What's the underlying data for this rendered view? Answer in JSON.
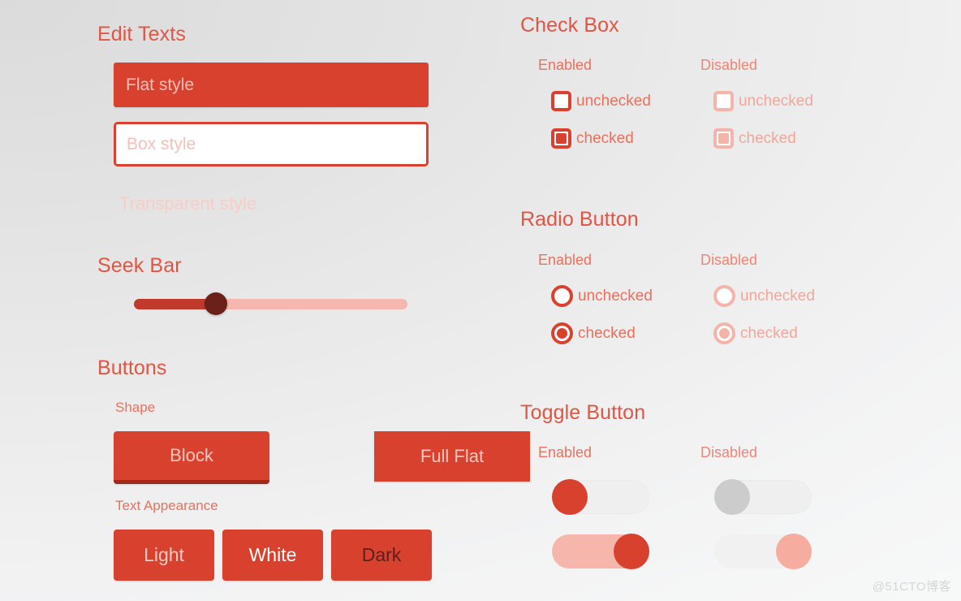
{
  "theme": {
    "accent": "#d9412f",
    "accent_dark": "#9e2a1d",
    "accent_light": "#f6b8ae",
    "text_on_accent_light": "#f6c6bf",
    "title_color": "#e05543",
    "label_color": "#e8705d",
    "disabled_color": "#f4b4a9",
    "background_from": "#dbdbdb",
    "background_to": "#f7f8f8"
  },
  "edit_texts": {
    "title": "Edit Texts",
    "flat": {
      "placeholder": "Flat style",
      "value": ""
    },
    "box": {
      "placeholder": "Box style",
      "value": ""
    },
    "transparent": {
      "placeholder": "Transparent style",
      "value": ""
    }
  },
  "seek_bar": {
    "title": "Seek Bar",
    "value": 30,
    "min": 0,
    "max": 100,
    "progress_percent": "30%"
  },
  "buttons": {
    "title": "Buttons",
    "shape": {
      "label": "Shape",
      "items": [
        {
          "label": "Block",
          "style": "block"
        },
        {
          "label": "Full Flat",
          "style": "full-flat"
        }
      ]
    },
    "text_appearance": {
      "label": "Text Appearance",
      "items": [
        {
          "label": "Light",
          "style": "light"
        },
        {
          "label": "White",
          "style": "white"
        },
        {
          "label": "Dark",
          "style": "dark"
        }
      ]
    }
  },
  "check_box": {
    "title": "Check Box",
    "columns": [
      {
        "header": "Enabled",
        "state": "enabled"
      },
      {
        "header": "Disabled",
        "state": "disabled"
      }
    ],
    "rows": [
      {
        "label": "unchecked",
        "checked": false
      },
      {
        "label": "checked",
        "checked": true
      }
    ]
  },
  "radio_button": {
    "title": "Radio Button",
    "columns": [
      {
        "header": "Enabled",
        "state": "enabled"
      },
      {
        "header": "Disabled",
        "state": "disabled"
      }
    ],
    "rows": [
      {
        "label": "unchecked",
        "checked": false
      },
      {
        "label": "checked",
        "checked": true
      }
    ]
  },
  "toggle_button": {
    "title": "Toggle Button",
    "columns": [
      {
        "header": "Enabled",
        "state": "enabled"
      },
      {
        "header": "Disabled",
        "state": "disabled"
      }
    ],
    "rows": [
      {
        "enabled_on": false,
        "disabled_on": false
      },
      {
        "enabled_on": true,
        "disabled_on": true
      }
    ]
  },
  "watermark": {
    "text": "@51CTO博客"
  }
}
